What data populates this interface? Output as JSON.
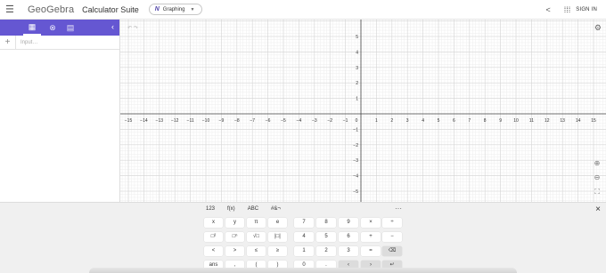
{
  "header": {
    "menu_icon": "hamburger-icon",
    "brand": "GeoGebra",
    "suite": "Calculator Suite",
    "app_label": "Graphing",
    "signin": "SIGN IN"
  },
  "algebra": {
    "input_placeholder": "Input…"
  },
  "graph": {
    "x_ticks": [
      "−15",
      "−14",
      "−13",
      "−12",
      "−11",
      "−10",
      "−9",
      "−8",
      "−7",
      "−6",
      "−5",
      "−4",
      "−3",
      "−2",
      "−1",
      "0",
      "1",
      "2",
      "3",
      "4",
      "5",
      "6",
      "7",
      "8",
      "9",
      "10",
      "11",
      "12",
      "13",
      "14",
      "15"
    ],
    "y_ticks": [
      "5",
      "4",
      "3",
      "2",
      "1",
      "−1",
      "−2",
      "−3",
      "−4",
      "−5"
    ]
  },
  "keyboard": {
    "tabs": [
      "123",
      "f(x)",
      "ABC",
      "#&¬"
    ],
    "more": "···",
    "close": "×",
    "rows": [
      [
        "x",
        "y",
        "π",
        "e",
        "7",
        "8",
        "9",
        "×",
        "÷"
      ],
      [
        "□²",
        "□ⁿ",
        "√□",
        "|□|",
        "4",
        "5",
        "6",
        "+",
        "−"
      ],
      [
        "<",
        ">",
        "≤",
        "≥",
        "1",
        "2",
        "3",
        "=",
        "⌫"
      ],
      [
        "ans",
        ",",
        "(",
        ")",
        "0",
        ".",
        "‹",
        "›",
        "↵"
      ]
    ]
  }
}
